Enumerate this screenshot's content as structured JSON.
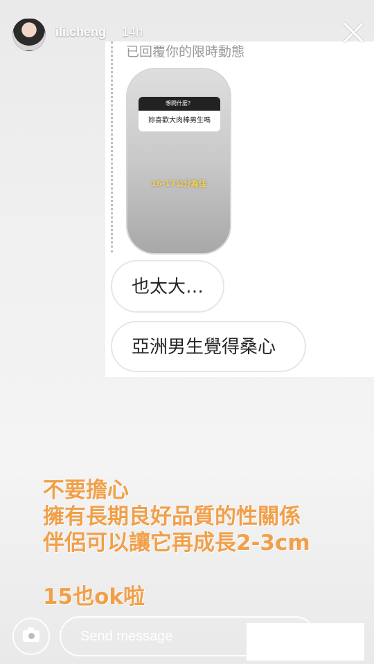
{
  "header": {
    "username": "ili.cheng",
    "time": "14h"
  },
  "reply": {
    "label": "已回覆你的限時動態"
  },
  "story_preview": {
    "question_title": "想問什麼？",
    "question": "妳喜歡大肉棒男生嗎",
    "answer": "16-17公分為佳"
  },
  "messages": [
    {
      "text": "也太大…"
    },
    {
      "text": "亞洲男生覺得桑心"
    }
  ],
  "caption": {
    "lines": [
      "不要擔心",
      "擁有長期良好品質的性關係",
      "伴侶可以讓它再成長2-3cm"
    ],
    "footer": "15也ok啦"
  },
  "bottom_bar": {
    "placeholder": "Send message",
    "camera_icon": "camera-icon"
  },
  "colors": {
    "caption": "#f0a04a",
    "thumb_answer": "#f5d24a"
  }
}
